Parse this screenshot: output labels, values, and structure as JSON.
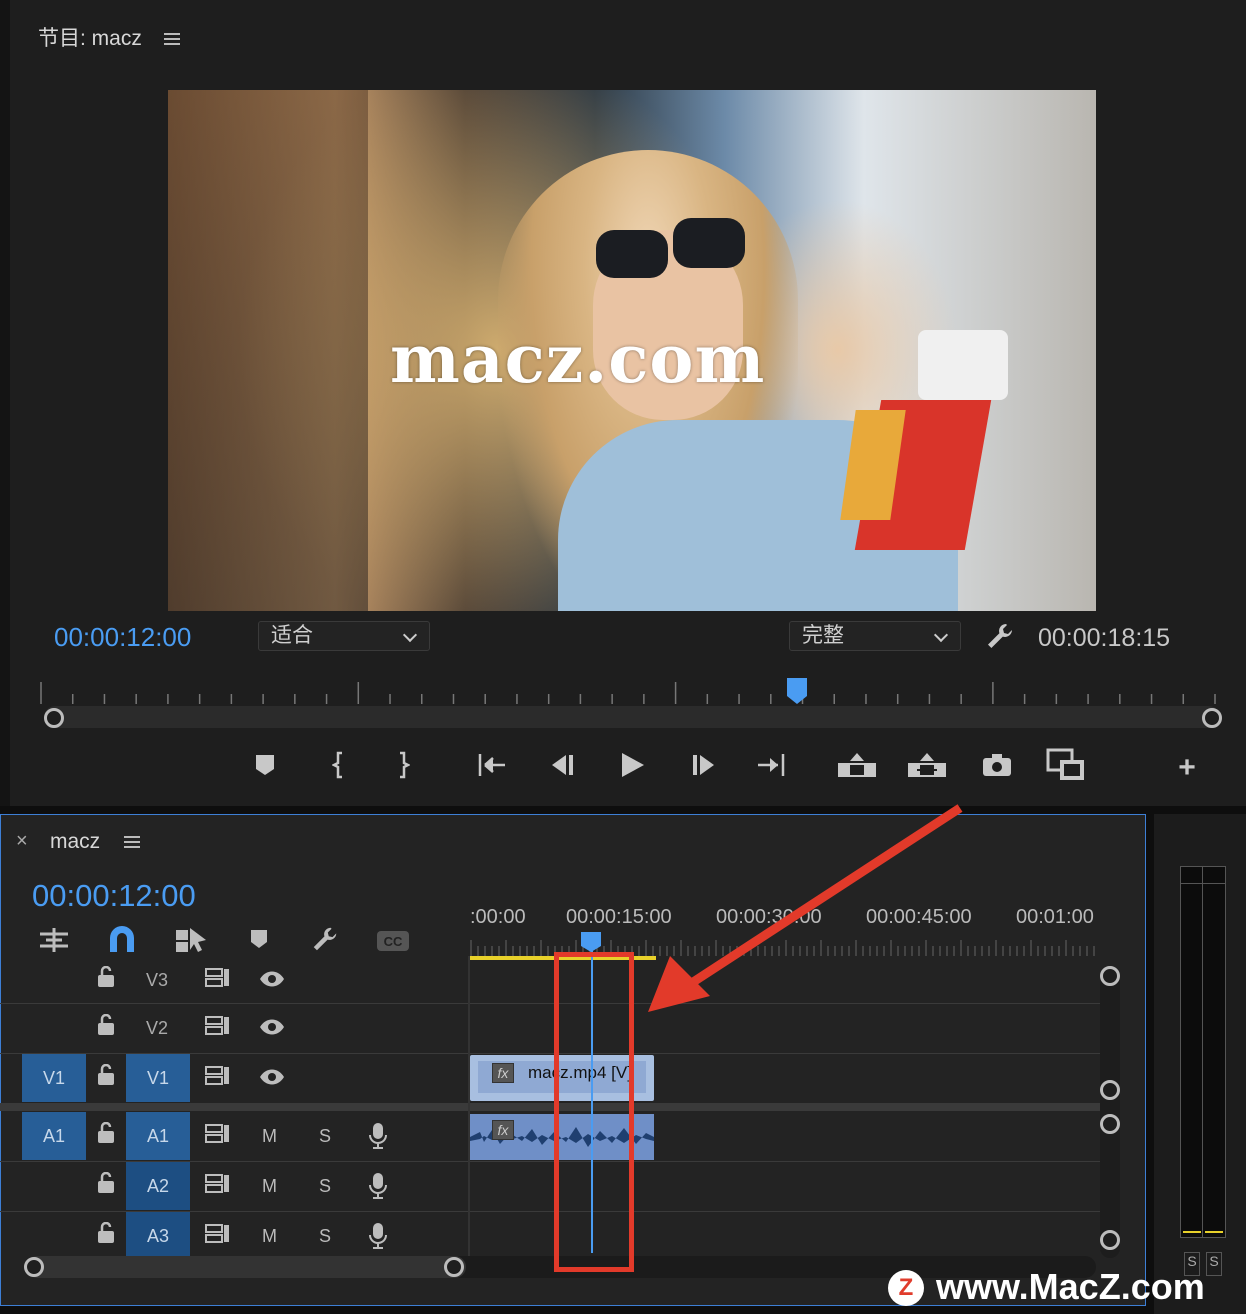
{
  "program_monitor": {
    "panel_label": "节目: macz",
    "watermark_text": "macz.com",
    "current_timecode": "00:00:12:00",
    "fit_select": "适合",
    "quality_select": "完整",
    "duration_timecode": "00:00:18:15",
    "playback_position_fraction": 0.64
  },
  "timeline": {
    "close_symbol": "×",
    "sequence_name": "macz",
    "current_timecode": "00:00:12:00",
    "ruler_labels": [
      ":00:00",
      "00:00:15:00",
      "00:00:30:00",
      "00:00:45:00",
      "00:01:00"
    ],
    "tracks": {
      "v3": "V3",
      "v2": "V2",
      "v1_source": "V1",
      "v1": "V1",
      "a1_source": "A1",
      "a1": "A1",
      "a2": "A2",
      "a3": "A3",
      "mute": "M",
      "solo": "S"
    },
    "clip_name": "macz.mp4 [V]",
    "audio_meter_labels": [
      "S",
      "S"
    ]
  },
  "overlay": {
    "site_text": "www.MacZ.com",
    "site_logo_letter": "Z",
    "annotation_color": "#e23a2a"
  },
  "colors": {
    "accent_blue": "#4a9cf2",
    "track_tag_blue": "#275e97",
    "clip_video": "#a8bfe0",
    "clip_audio": "#6f8fc7"
  }
}
